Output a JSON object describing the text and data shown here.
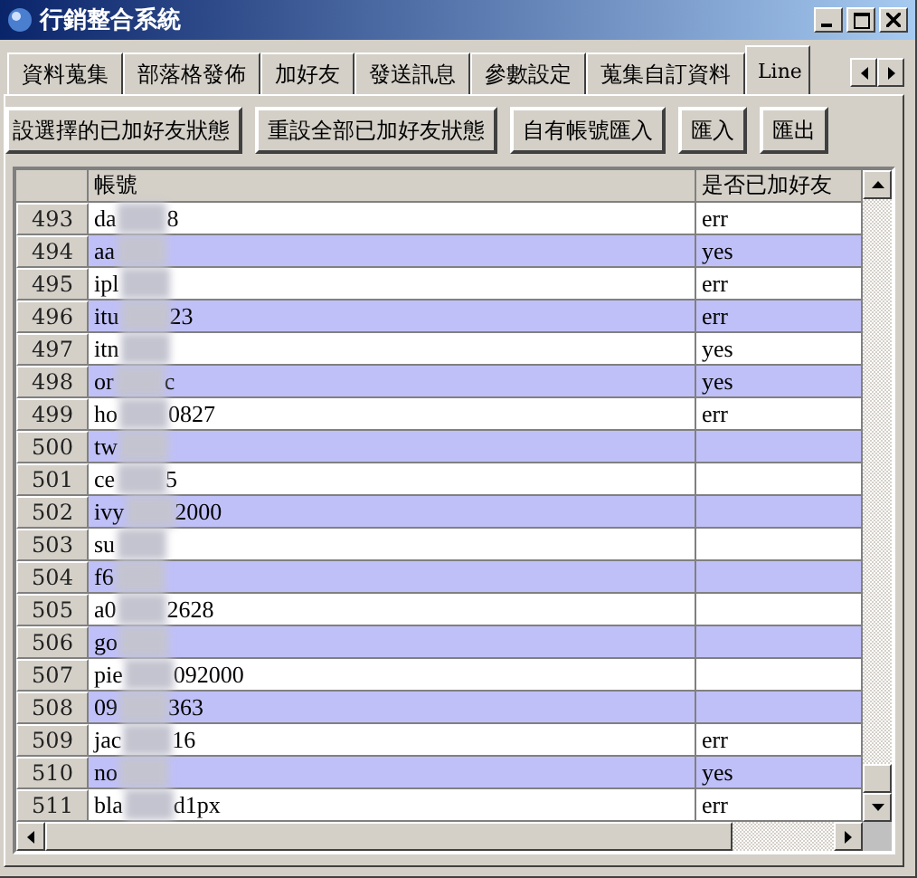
{
  "window": {
    "title": "行銷整合系統"
  },
  "tabs": [
    {
      "label": "資料蒐集",
      "selected": false
    },
    {
      "label": "部落格發佈",
      "selected": false
    },
    {
      "label": "加好友",
      "selected": false
    },
    {
      "label": "發送訊息",
      "selected": false
    },
    {
      "label": "參數設定",
      "selected": false
    },
    {
      "label": "蒐集自訂資料",
      "selected": false
    },
    {
      "label": "Line",
      "selected": true
    }
  ],
  "buttons": [
    "設選擇的已加好友狀態",
    "重設全部已加好友狀態",
    "自有帳號匯入",
    "匯入",
    "匯出"
  ],
  "table": {
    "columns": [
      "帳號",
      "是否已加好友"
    ],
    "rows": [
      {
        "index": "493",
        "account_start": "da",
        "account_end": "8",
        "status": "err"
      },
      {
        "index": "494",
        "account_start": "aa",
        "account_end": "",
        "status": "yes"
      },
      {
        "index": "495",
        "account_start": "ipl",
        "account_end": "",
        "status": "err"
      },
      {
        "index": "496",
        "account_start": "itu",
        "account_end": "23",
        "status": "err"
      },
      {
        "index": "497",
        "account_start": "itn",
        "account_end": "",
        "status": "yes"
      },
      {
        "index": "498",
        "account_start": "or",
        "account_end": "c",
        "status": "yes"
      },
      {
        "index": "499",
        "account_start": "ho",
        "account_end": "0827",
        "status": "err"
      },
      {
        "index": "500",
        "account_start": "tw",
        "account_end": "",
        "status": ""
      },
      {
        "index": "501",
        "account_start": "ce",
        "account_end": "5",
        "status": ""
      },
      {
        "index": "502",
        "account_start": "ivy",
        "account_end": "2000",
        "status": ""
      },
      {
        "index": "503",
        "account_start": "su",
        "account_end": "",
        "status": ""
      },
      {
        "index": "504",
        "account_start": "f6",
        "account_end": "",
        "status": ""
      },
      {
        "index": "505",
        "account_start": "a0",
        "account_end": "2628",
        "status": ""
      },
      {
        "index": "506",
        "account_start": "go",
        "account_end": "",
        "status": ""
      },
      {
        "index": "507",
        "account_start": "pie",
        "account_end": "092000",
        "status": ""
      },
      {
        "index": "508",
        "account_start": "09",
        "account_end": "363",
        "status": ""
      },
      {
        "index": "509",
        "account_start": "jac",
        "account_end": "16",
        "status": "err"
      },
      {
        "index": "510",
        "account_start": "no",
        "account_end": "",
        "status": "yes"
      },
      {
        "index": "511",
        "account_start": "bla",
        "account_end": "d1px",
        "status": "err"
      }
    ]
  }
}
